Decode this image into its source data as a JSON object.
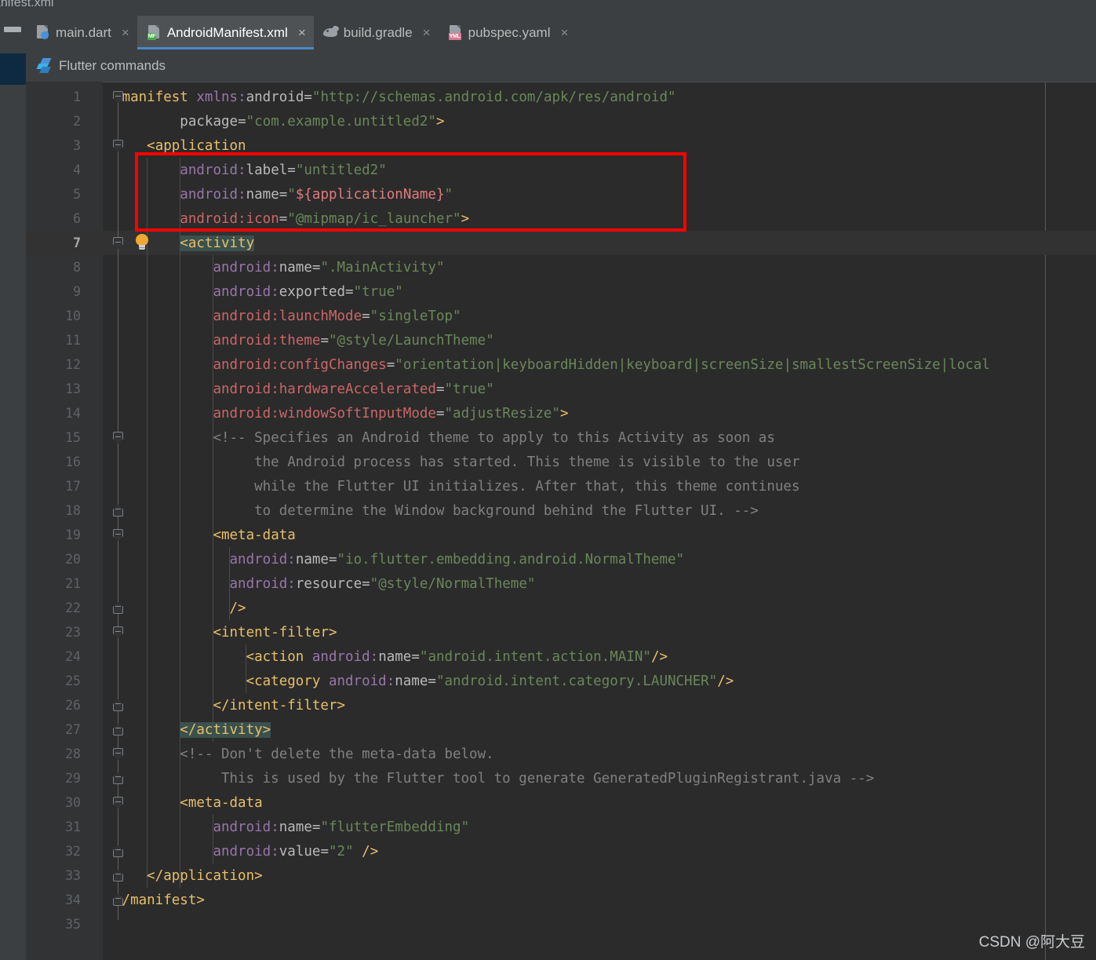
{
  "breadcrumb": {
    "text": "anifest.xml"
  },
  "window": {
    "accent_color": "#4a88c7",
    "editor_bg": "#2b2b2b",
    "gutter_bg": "#313335",
    "chrome_bg": "#3c3f41",
    "annotation_color": "#ff0000"
  },
  "left_rail": {
    "minimize_icon": "minimize-bar-icon",
    "active_block_color": "#0d2a42"
  },
  "tabs": [
    {
      "label": "main.dart",
      "icon": "dart-file-icon",
      "badge": "",
      "close": "×",
      "active": false
    },
    {
      "label": "AndroidManifest.xml",
      "icon": "xml-file-icon",
      "badge": "MF",
      "close": "×",
      "active": true
    },
    {
      "label": "build.gradle",
      "icon": "gradle-file-icon",
      "badge": "",
      "close": "×",
      "active": false
    },
    {
      "label": "pubspec.yaml",
      "icon": "yaml-file-icon",
      "badge": "YML",
      "close": "×",
      "active": false
    }
  ],
  "commands_bar": {
    "label": "Flutter commands",
    "icon": "flutter-logo-icon"
  },
  "editor": {
    "current_line": 7,
    "total_visible_lines": 35,
    "right_margin_column_guide": true,
    "lines": [
      {
        "n": 1,
        "text": "<manifest xmlns:android=\"http://schemas.android.com/apk/res/android\""
      },
      {
        "n": 2,
        "text": "        package=\"com.example.untitled2\">"
      },
      {
        "n": 3,
        "text": "    <application"
      },
      {
        "n": 4,
        "text": "        android:label=\"untitled2\""
      },
      {
        "n": 5,
        "text": "        android:name=\"${applicationName}\""
      },
      {
        "n": 6,
        "text": "        android:icon=\"@mipmap/ic_launcher\">"
      },
      {
        "n": 7,
        "text": "        <activity"
      },
      {
        "n": 8,
        "text": "            android:name=\".MainActivity\""
      },
      {
        "n": 9,
        "text": "            android:exported=\"true\""
      },
      {
        "n": 10,
        "text": "            android:launchMode=\"singleTop\""
      },
      {
        "n": 11,
        "text": "            android:theme=\"@style/LaunchTheme\""
      },
      {
        "n": 12,
        "text": "            android:configChanges=\"orientation|keyboardHidden|keyboard|screenSize|smallestScreenSize|local"
      },
      {
        "n": 13,
        "text": "            android:hardwareAccelerated=\"true\""
      },
      {
        "n": 14,
        "text": "            android:windowSoftInputMode=\"adjustResize\">"
      },
      {
        "n": 15,
        "text": "            <!-- Specifies an Android theme to apply to this Activity as soon as"
      },
      {
        "n": 16,
        "text": "                 the Android process has started. This theme is visible to the user"
      },
      {
        "n": 17,
        "text": "                 while the Flutter UI initializes. After that, this theme continues"
      },
      {
        "n": 18,
        "text": "                 to determine the Window background behind the Flutter UI. -->"
      },
      {
        "n": 19,
        "text": "            <meta-data"
      },
      {
        "n": 20,
        "text": "              android:name=\"io.flutter.embedding.android.NormalTheme\""
      },
      {
        "n": 21,
        "text": "              android:resource=\"@style/NormalTheme\""
      },
      {
        "n": 22,
        "text": "              />"
      },
      {
        "n": 23,
        "text": "            <intent-filter>"
      },
      {
        "n": 24,
        "text": "                <action android:name=\"android.intent.action.MAIN\"/>"
      },
      {
        "n": 25,
        "text": "                <category android:name=\"android.intent.category.LAUNCHER\"/>"
      },
      {
        "n": 26,
        "text": "            </intent-filter>"
      },
      {
        "n": 27,
        "text": "        </activity>"
      },
      {
        "n": 28,
        "text": "        <!-- Don't delete the meta-data below."
      },
      {
        "n": 29,
        "text": "             This is used by the Flutter tool to generate GeneratedPluginRegistrant.java -->"
      },
      {
        "n": 30,
        "text": "        <meta-data"
      },
      {
        "n": 31,
        "text": "            android:name=\"flutterEmbedding\""
      },
      {
        "n": 32,
        "text": "            android:value=\"2\" />"
      },
      {
        "n": 33,
        "text": "    </application>"
      },
      {
        "n": 34,
        "text": "</manifest>"
      },
      {
        "n": 35,
        "text": ""
      }
    ],
    "intention_bulb": {
      "line": 7,
      "icon": "lightbulb-icon"
    },
    "fold_markers": [
      {
        "line": 1,
        "state": "open"
      },
      {
        "line": 3,
        "state": "open"
      },
      {
        "line": 7,
        "state": "open"
      },
      {
        "line": 15,
        "state": "open"
      },
      {
        "line": 18,
        "state": "close"
      },
      {
        "line": 19,
        "state": "open"
      },
      {
        "line": 22,
        "state": "close"
      },
      {
        "line": 23,
        "state": "open"
      },
      {
        "line": 26,
        "state": "close"
      },
      {
        "line": 27,
        "state": "close"
      },
      {
        "line": 28,
        "state": "open"
      },
      {
        "line": 29,
        "state": "close"
      },
      {
        "line": 30,
        "state": "open"
      },
      {
        "line": 32,
        "state": "close"
      },
      {
        "line": 33,
        "state": "close"
      },
      {
        "line": 34,
        "state": "close"
      }
    ],
    "highlighted_tags": [
      "<activity",
      "</activity>"
    ],
    "syntax_colors": {
      "tag": "#e8bf6a",
      "attribute": "#bababa",
      "namespace": "#9876aa",
      "namespace_error": "#cc6666",
      "value": "#6a8759",
      "comment": "#808080",
      "template_var": "#e07c7c",
      "punctuation": "#a9b7c6",
      "tag_match_highlight": "#3b514d"
    }
  },
  "watermark": {
    "text": "CSDN @阿大豆"
  }
}
